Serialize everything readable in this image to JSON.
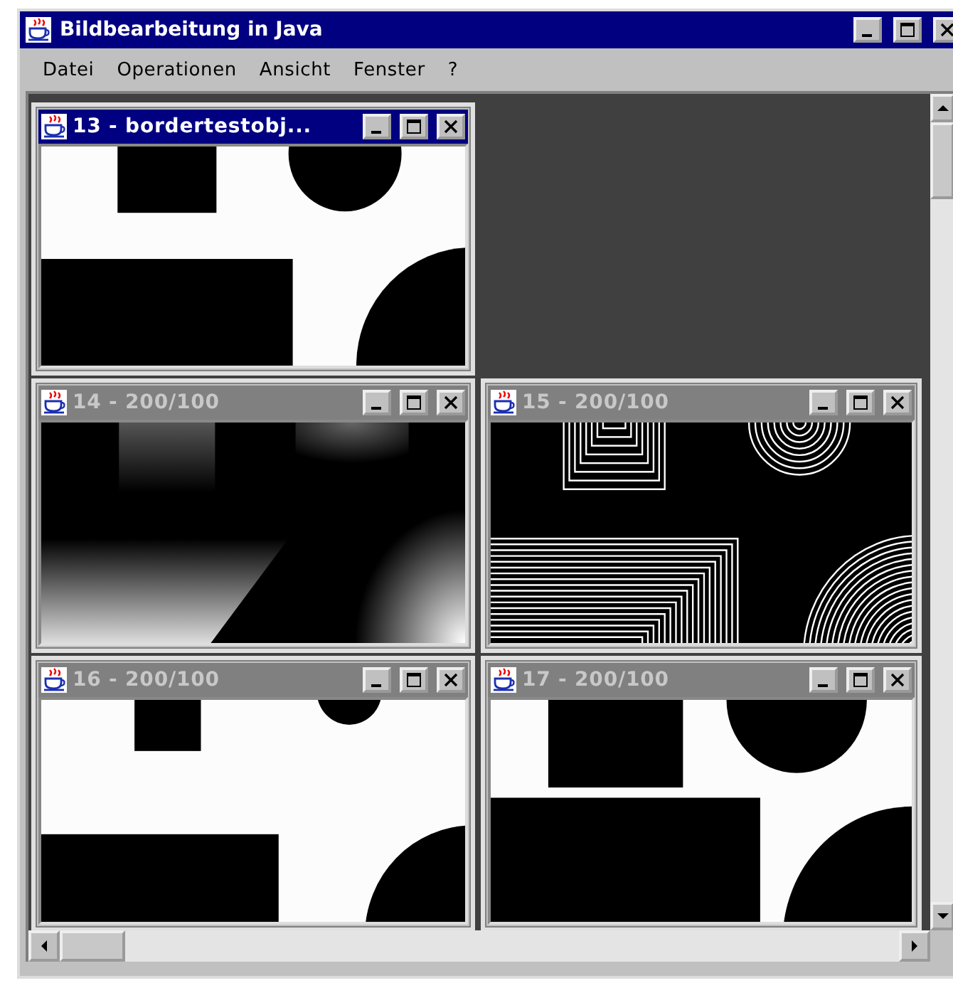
{
  "window": {
    "title": "Bildbearbeitung in Java"
  },
  "menu": [
    {
      "label": "Datei"
    },
    {
      "label": "Operationen"
    },
    {
      "label": "Ansicht"
    },
    {
      "label": "Fenster"
    },
    {
      "label": "?"
    }
  ],
  "frames": [
    {
      "title": "13 - bordertestobj...",
      "active": true,
      "image": {
        "kind": "shapes"
      }
    },
    {
      "title": "14 - 200/100",
      "active": false,
      "image": {
        "kind": "gradient"
      }
    },
    {
      "title": "15 - 200/100",
      "active": false,
      "image": {
        "kind": "contours"
      }
    },
    {
      "title": "16 - 200/100",
      "active": false,
      "image": {
        "kind": "shapes"
      }
    },
    {
      "title": "17 - 200/100",
      "active": false,
      "image": {
        "kind": "shapes"
      }
    }
  ]
}
